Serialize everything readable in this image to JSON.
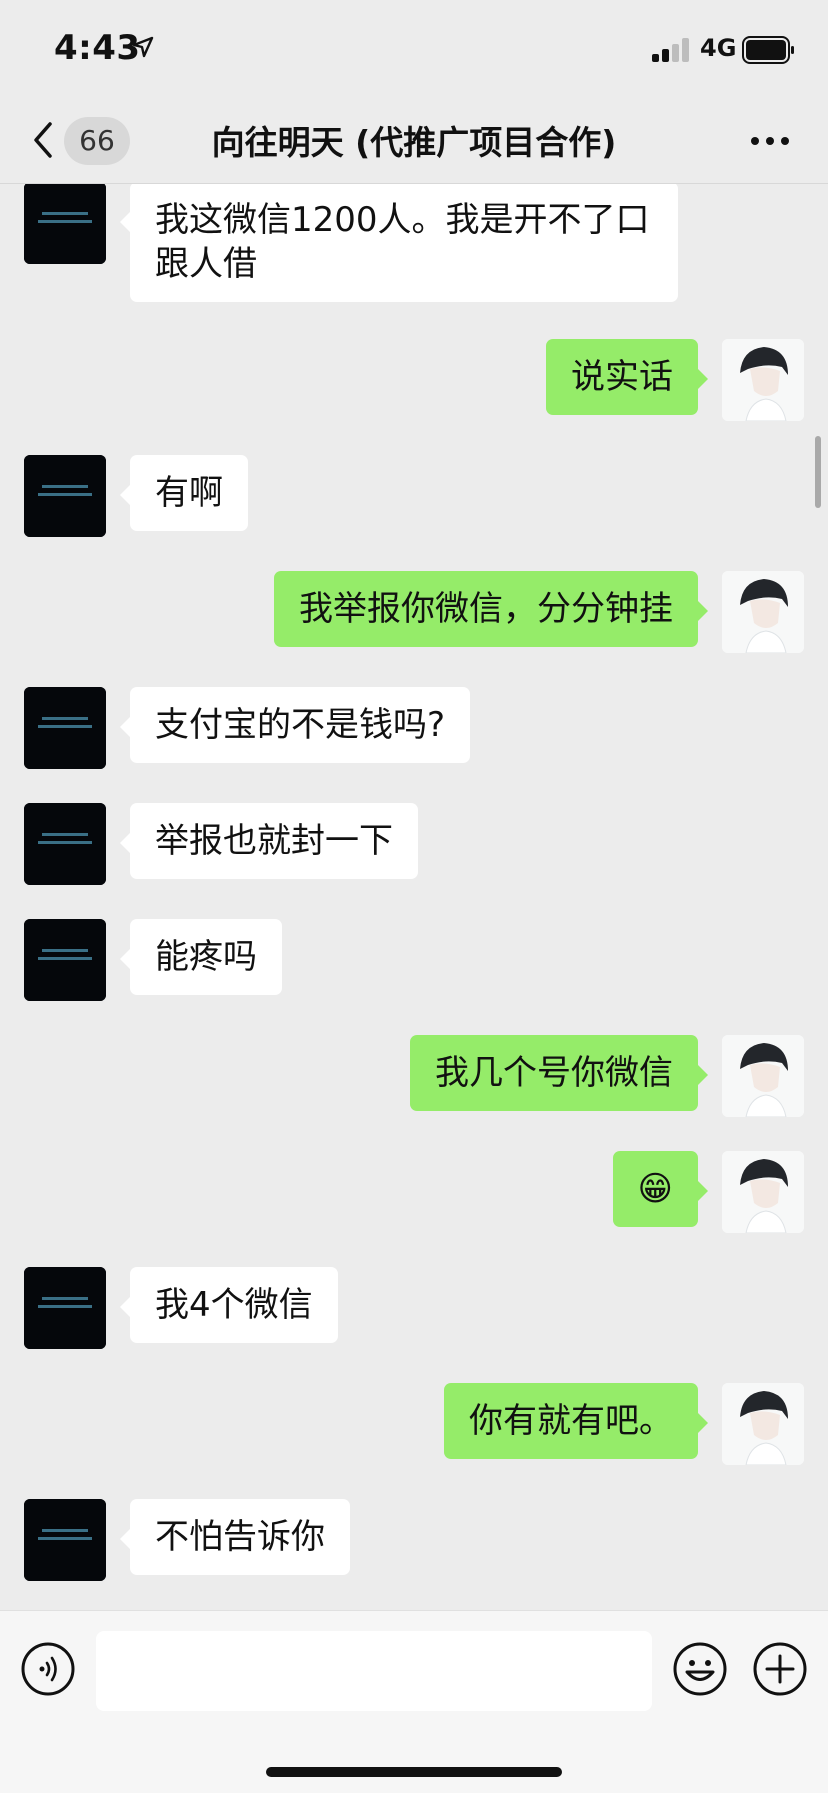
{
  "status_bar": {
    "time": "4:43",
    "network": "4G"
  },
  "nav": {
    "back_count": "66",
    "title": "向往明天 (代推广项目合作)"
  },
  "messages": [
    {
      "side": "left",
      "text": "我这微信1200人。我是开不了口跟人借"
    },
    {
      "side": "right",
      "text": "说实话"
    },
    {
      "side": "left",
      "text": "有啊"
    },
    {
      "side": "right",
      "text": "我举报你微信，分分钟挂"
    },
    {
      "side": "left",
      "text": "支付宝的不是钱吗?"
    },
    {
      "side": "left",
      "text": "举报也就封一下"
    },
    {
      "side": "left",
      "text": "能疼吗"
    },
    {
      "side": "right",
      "text": "我几个号你微信"
    },
    {
      "side": "right",
      "text": "😁"
    },
    {
      "side": "left",
      "text": "我4个微信"
    },
    {
      "side": "right",
      "text": "你有就有吧。"
    },
    {
      "side": "left",
      "text": "不怕告诉你"
    }
  ],
  "input": {
    "value": ""
  },
  "colors": {
    "own_bubble": "#95ec69",
    "other_bubble": "#ffffff",
    "background": "#ececec"
  }
}
